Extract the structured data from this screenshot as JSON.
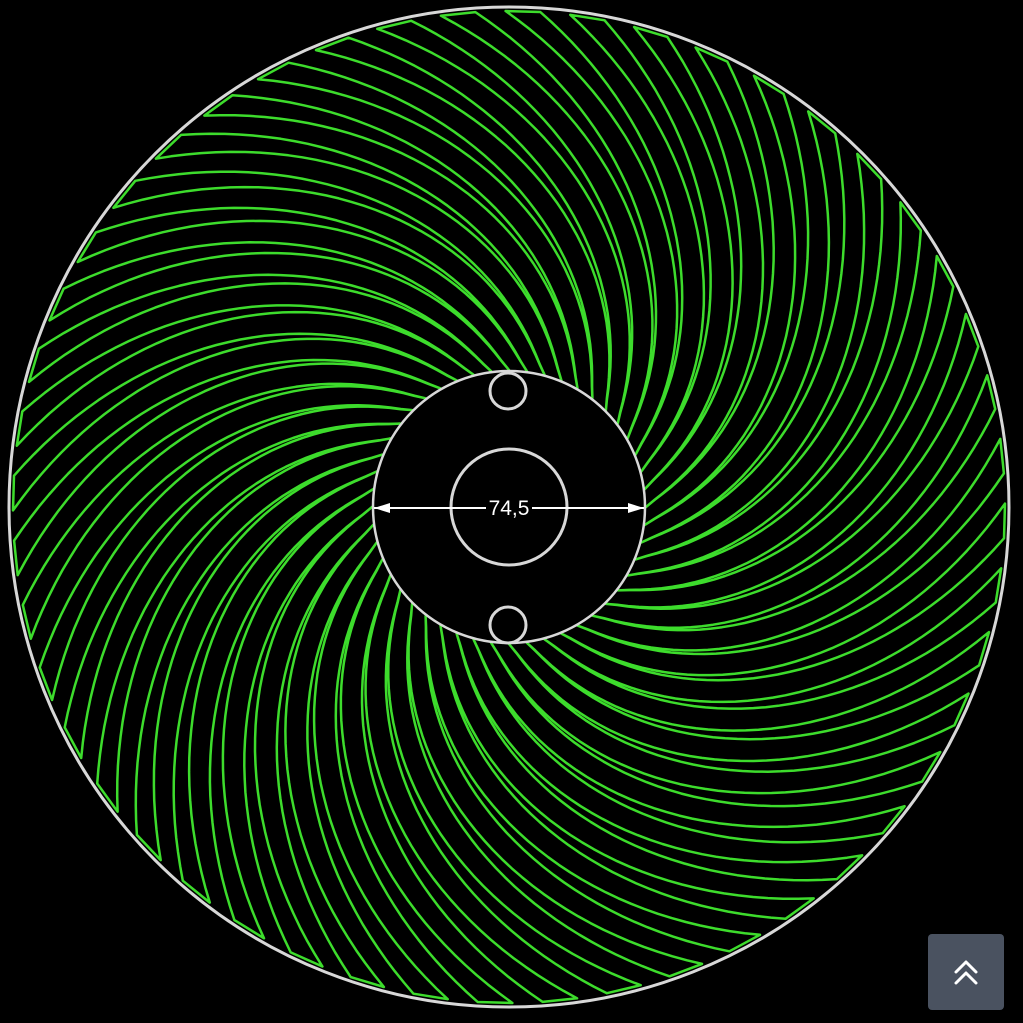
{
  "drawing": {
    "dimension_label": "74,5",
    "blade_count": 48,
    "colors": {
      "background": "#000000",
      "blade_stroke": "#3ddc2c",
      "outline_stroke": "#d8d8d8",
      "dimension_stroke": "#ffffff"
    }
  },
  "scroll_top_button": {
    "icon": "double-chevron-up-icon",
    "background": "#4a5260",
    "icon_color": "#ffffff"
  }
}
